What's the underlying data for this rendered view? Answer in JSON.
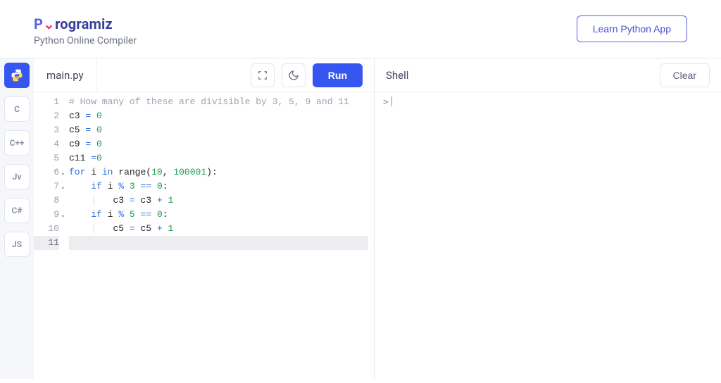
{
  "header": {
    "logo_text": "Programiz",
    "subtitle": "Python Online Compiler",
    "learn_button": "Learn Python App"
  },
  "sidebar": {
    "items": [
      {
        "label": "Py",
        "active": true
      },
      {
        "label": "C"
      },
      {
        "label": "C++"
      },
      {
        "label": "Jv"
      },
      {
        "label": "C#"
      },
      {
        "label": "JS"
      }
    ]
  },
  "editor": {
    "filename": "main.py",
    "run_label": "Run",
    "line_numbers": [
      "1",
      "2",
      "3",
      "4",
      "5",
      "6",
      "7",
      "8",
      "9",
      "10",
      "11"
    ],
    "fold_lines": [
      6,
      7,
      9
    ],
    "current_line": 11,
    "lines": [
      {
        "type": "comment",
        "text": "# How many of these are divisible by 3, 5, 9 and 11"
      },
      {
        "type": "assign",
        "var": "c3",
        "eq": "=",
        "val": "0"
      },
      {
        "type": "assign",
        "var": "c5",
        "eq": "=",
        "val": "0"
      },
      {
        "type": "assign",
        "var": "c9",
        "eq": "=",
        "val": "0"
      },
      {
        "type": "assign_compact",
        "var": "c11",
        "eq": "=",
        "val": "0"
      },
      {
        "type": "for",
        "kw1": "for",
        "var": "i",
        "kw2": "in",
        "fn": "range",
        "open": "(",
        "a": "10",
        "comma": ", ",
        "b": "100001",
        "close": "):"
      },
      {
        "type": "if",
        "indent": 1,
        "kw": "if",
        "expr_var": "i",
        "mod": "%",
        "mod_n": "3",
        "eqeq": "==",
        "zero": "0",
        "colon": ":"
      },
      {
        "type": "inc",
        "indent": 2,
        "lhs": "c3",
        "eq": "=",
        "rhs_var": "c3",
        "plus": "+",
        "one": "1"
      },
      {
        "type": "if",
        "indent": 1,
        "kw": "if",
        "expr_var": "i",
        "mod": "%",
        "mod_n": "5",
        "eqeq": "==",
        "zero": "0",
        "colon": ":"
      },
      {
        "type": "inc",
        "indent": 2,
        "lhs": "c5",
        "eq": "=",
        "rhs_var": "c5",
        "plus": "+",
        "one": "1"
      },
      {
        "type": "blank"
      }
    ]
  },
  "shell": {
    "title": "Shell",
    "clear_label": "Clear",
    "prompt": ">"
  }
}
